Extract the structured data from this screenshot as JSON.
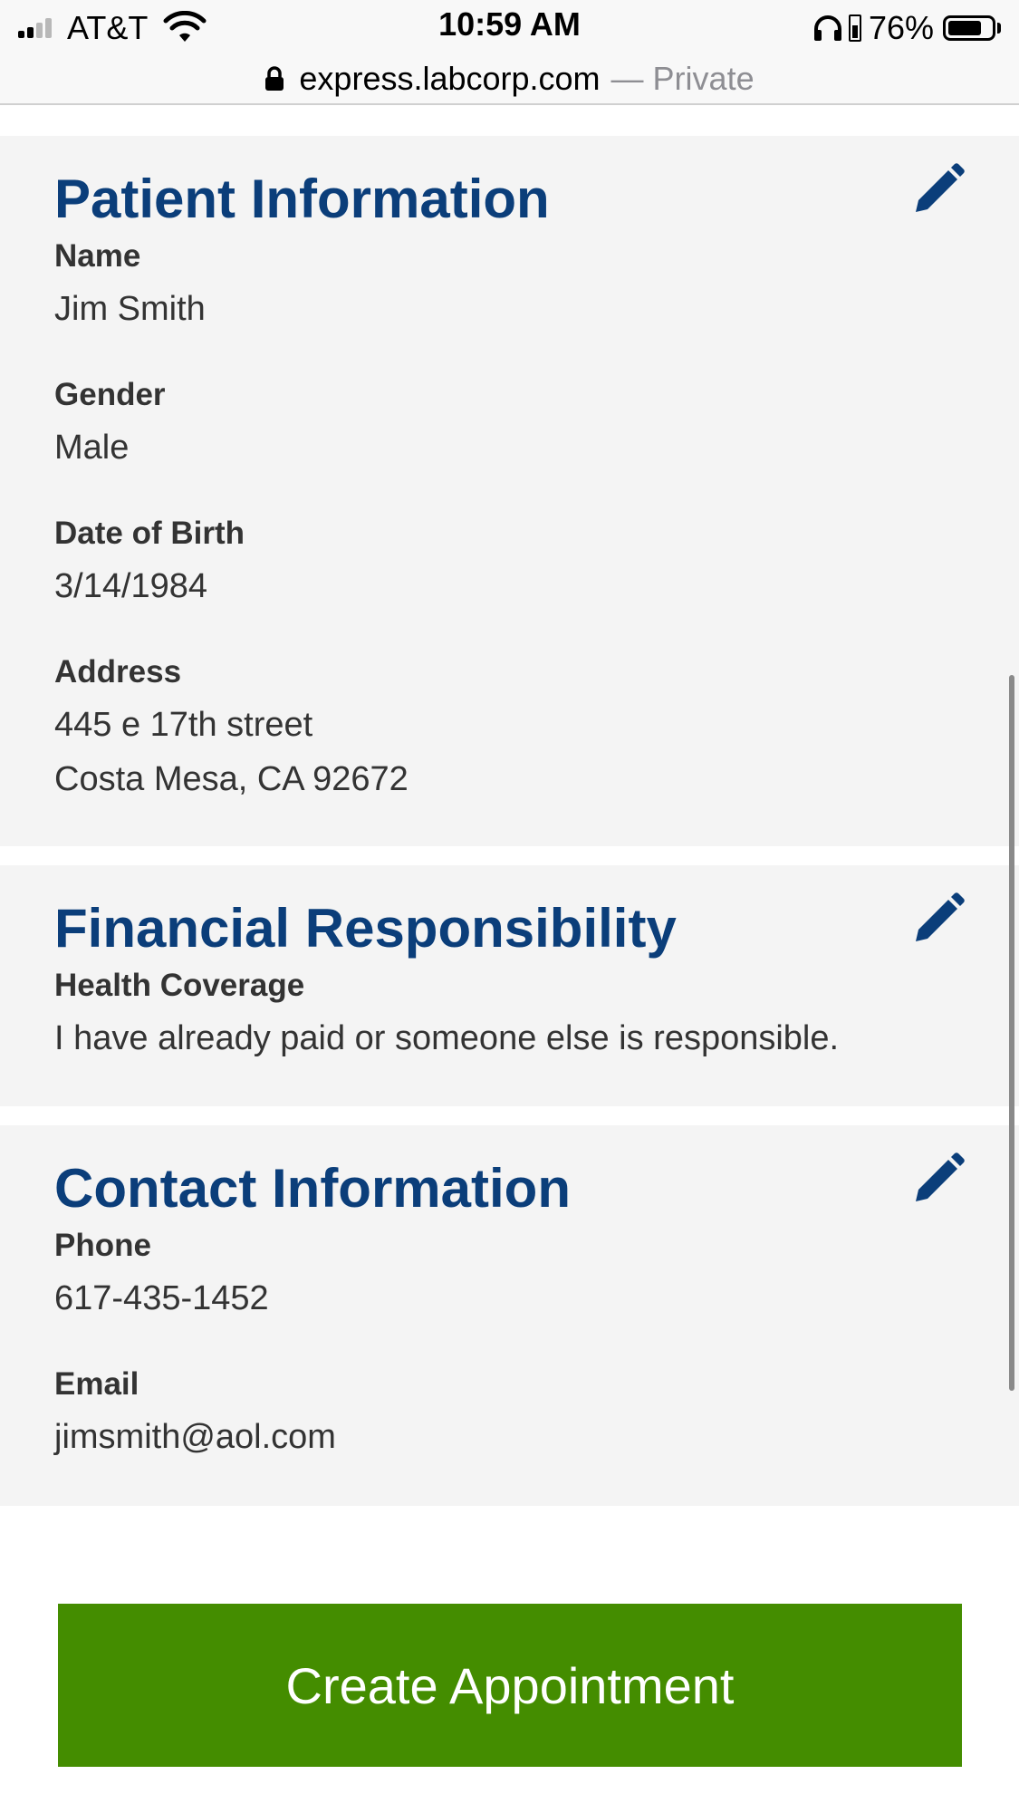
{
  "status_bar": {
    "carrier": "AT&T",
    "time": "10:59 AM",
    "battery_percent": "76%",
    "signal_bars_filled": 2,
    "icons": [
      "signal-icon",
      "wifi-icon",
      "headphones-icon",
      "charging-icon",
      "battery-icon"
    ]
  },
  "browser": {
    "domain": "express.labcorp.com",
    "mode": "— Private",
    "icon": "lock-icon"
  },
  "patient_info": {
    "title": "Patient Information",
    "name_label": "Name",
    "name": "Jim Smith",
    "gender_label": "Gender",
    "gender": "Male",
    "dob_label": "Date of Birth",
    "dob": "3/14/1984",
    "address_label": "Address",
    "address_line1": "445 e 17th street",
    "address_line2": "Costa Mesa, CA 92672",
    "edit_icon": "pencil-icon"
  },
  "financial": {
    "title": "Financial Responsibility",
    "coverage_label": "Health Coverage",
    "coverage_value": "I have already paid or someone else is responsible.",
    "edit_icon": "pencil-icon"
  },
  "contact": {
    "title": "Contact Information",
    "phone_label": "Phone",
    "phone": "617-435-1452",
    "email_label": "Email",
    "email": "jimsmith@aol.com",
    "edit_icon": "pencil-icon"
  },
  "actions": {
    "create_appointment": "Create Appointment"
  },
  "colors": {
    "heading": "#0b3e7a",
    "card_background": "#f4f4f4",
    "button_background": "#448d00",
    "button_text": "#ffffff"
  }
}
